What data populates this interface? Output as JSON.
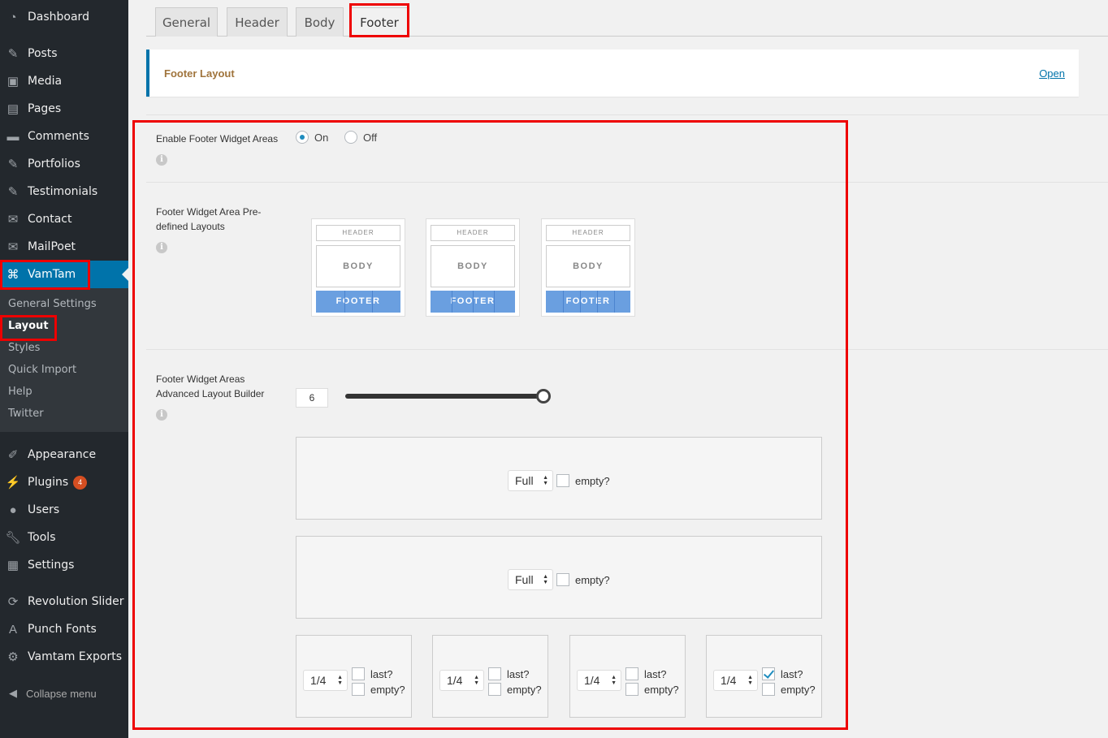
{
  "sidebar": {
    "menu": [
      {
        "label": "Dashboard",
        "icon": "dashboard-icon"
      },
      {
        "label": "Posts",
        "icon": "pin-icon"
      },
      {
        "label": "Media",
        "icon": "media-icon"
      },
      {
        "label": "Pages",
        "icon": "pages-icon"
      },
      {
        "label": "Comments",
        "icon": "comment-icon"
      },
      {
        "label": "Portfolios",
        "icon": "pin-icon"
      },
      {
        "label": "Testimonials",
        "icon": "pin-icon"
      },
      {
        "label": "Contact",
        "icon": "mail-icon"
      },
      {
        "label": "MailPoet",
        "icon": "envelope-icon"
      },
      {
        "label": "VamTam",
        "icon": "command-icon"
      }
    ],
    "submenu": [
      "General Settings",
      "Layout",
      "Styles",
      "Quick Import",
      "Help",
      "Twitter"
    ],
    "menu2": [
      {
        "label": "Appearance",
        "icon": "brush-icon"
      },
      {
        "label": "Plugins",
        "icon": "plug-icon",
        "badge": "4"
      },
      {
        "label": "Users",
        "icon": "user-icon"
      },
      {
        "label": "Tools",
        "icon": "wrench-icon"
      },
      {
        "label": "Settings",
        "icon": "settings-icon"
      }
    ],
    "menu3": [
      {
        "label": "Revolution Slider",
        "icon": "refresh-icon"
      },
      {
        "label": "Punch Fonts",
        "icon": "font-icon"
      },
      {
        "label": "Vamtam Exports",
        "icon": "gear-icon"
      }
    ],
    "collapse": "Collapse menu"
  },
  "tabs": [
    "General",
    "Header",
    "Body",
    "Footer"
  ],
  "section": {
    "title": "Footer Layout",
    "open": "Open"
  },
  "enable": {
    "label": "Enable Footer Widget Areas",
    "on": "On",
    "off": "Off",
    "selected": "On"
  },
  "predefined": {
    "label": "Footer Widget Area Pre-defined Layouts",
    "thumb": {
      "header": "HEADER",
      "body": "BODY",
      "footer": "FOOTER"
    }
  },
  "builder": {
    "label": "Footer Widget Areas Advanced Layout Builder",
    "count": "6",
    "slider_fraction": 1.0,
    "rows": [
      {
        "width": "Full",
        "empty_label": "empty?"
      },
      {
        "width": "Full",
        "empty_label": "empty?"
      }
    ],
    "quarters": [
      {
        "width": "1/4",
        "last_label": "last?",
        "empty_label": "empty?",
        "last": false
      },
      {
        "width": "1/4",
        "last_label": "last?",
        "empty_label": "empty?",
        "last": false
      },
      {
        "width": "1/4",
        "last_label": "last?",
        "empty_label": "empty?",
        "last": false
      },
      {
        "width": "1/4",
        "last_label": "last?",
        "empty_label": "empty?",
        "last": true
      }
    ]
  },
  "colors": {
    "accent": "#0073aa",
    "highlight": "#e00000",
    "sidebar": "#23282d"
  }
}
